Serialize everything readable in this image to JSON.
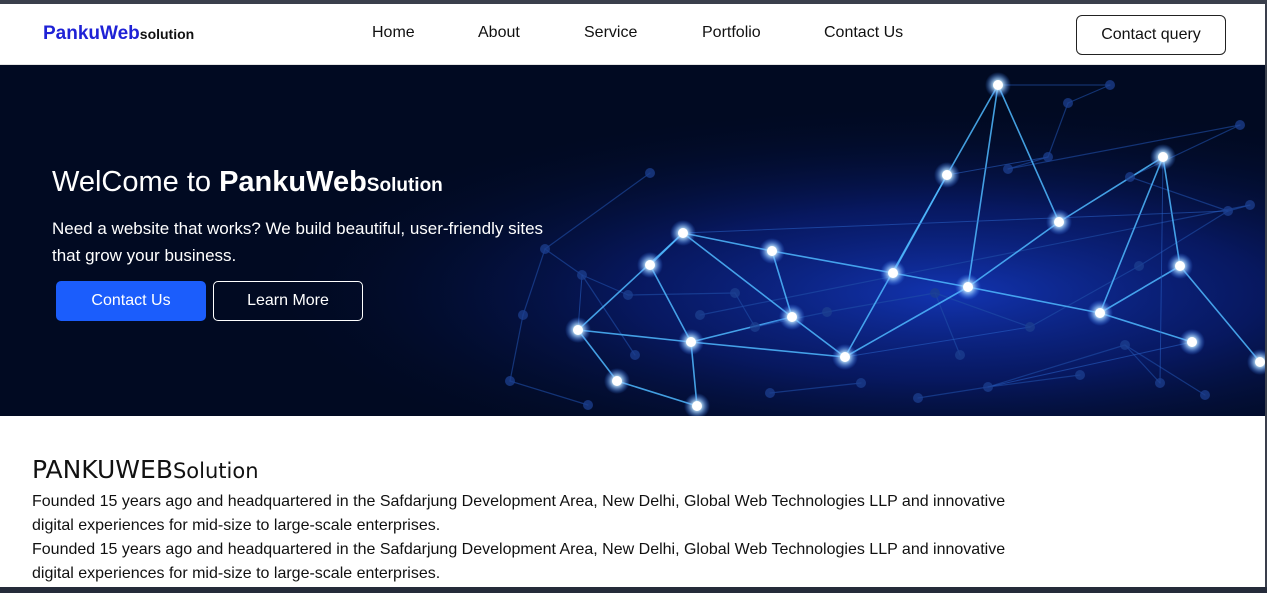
{
  "nav": {
    "brand_main": "PankuWeb",
    "brand_sub": "solution",
    "links": [
      "Home",
      "About",
      "Service",
      "Portfolio",
      "Contact Us"
    ],
    "cta_label": "Contact query"
  },
  "hero": {
    "title_prefix": "WelCome to ",
    "title_brand": "PankuWeb",
    "title_brand_sub": "Solution",
    "subtitle": "Need a website that works? We build beautiful, user-friendly sites that grow your business.",
    "primary_button": "Contact Us",
    "secondary_button": "Learn More"
  },
  "about": {
    "heading_main": "PANKUWEB",
    "heading_sub": "Solution",
    "paragraphs": [
      "Founded 15 years ago and headquartered in the Safdarjung Development Area, New Delhi, Global Web Technologies LLP and innovative digital experiences for mid-size to large-scale enterprises.",
      "Founded 15 years ago and headquartered in the Safdarjung Development Area, New Delhi, Global Web Technologies LLP and innovative digital experiences for mid-size to large-scale enterprises."
    ]
  },
  "colors": {
    "brand_blue": "#1f22d6",
    "primary_button": "#1b5dfc",
    "hero_background": "#010a22",
    "network_glow": "#4fb8ff"
  },
  "icons": {
    "hero_art": "network-graph-illustration"
  }
}
